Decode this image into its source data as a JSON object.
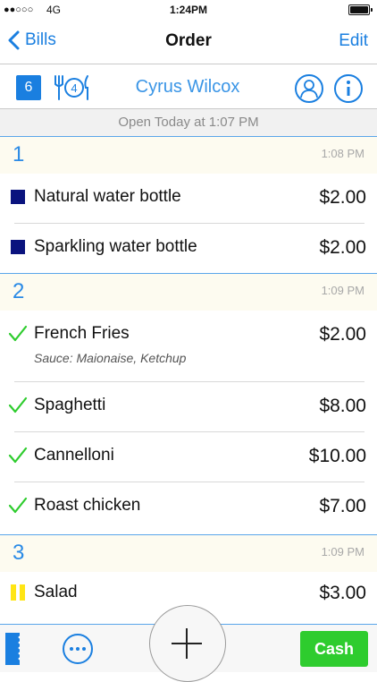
{
  "status_bar": {
    "signal": "●●○○○",
    "carrier": "4G",
    "time": "1:24PM"
  },
  "nav": {
    "back_label": "Bills",
    "title": "Order",
    "edit_label": "Edit"
  },
  "order_header": {
    "guests_badge": "6",
    "covers": "4",
    "customer_name": "Cyrus Wilcox",
    "open_info": "Open Today at 1:07 PM"
  },
  "rounds": [
    {
      "number": "1",
      "time": "1:08 PM",
      "items": [
        {
          "name": "Natural water bottle",
          "price": "$2.00",
          "status": "pending"
        },
        {
          "name": "Sparkling water bottle",
          "price": "$2.00",
          "status": "pending"
        }
      ]
    },
    {
      "number": "2",
      "time": "1:09 PM",
      "items": [
        {
          "name": "French Fries",
          "note": "Sauce: Maionaise, Ketchup",
          "price": "$2.00",
          "status": "served"
        },
        {
          "name": "Spaghetti",
          "price": "$8.00",
          "status": "served"
        },
        {
          "name": "Cannelloni",
          "price": "$10.00",
          "status": "served"
        },
        {
          "name": "Roast chicken",
          "price": "$7.00",
          "status": "served"
        }
      ]
    },
    {
      "number": "3",
      "time": "1:09 PM",
      "items": [
        {
          "name": "Salad",
          "price": "$3.00",
          "status": "on-hold"
        }
      ]
    }
  ],
  "toolbar": {
    "cash_label": "Cash"
  },
  "colors": {
    "accent": "#1a7fe0",
    "pending": "#0a137e",
    "served": "#2ecc2e",
    "on_hold": "#ffe514",
    "cash": "#2ecc2e"
  },
  "icons": [
    "back-chevron-icon",
    "cutlery-icon",
    "user-icon",
    "info-icon",
    "check-icon",
    "ticket-icon",
    "more-icon",
    "plus-icon"
  ]
}
